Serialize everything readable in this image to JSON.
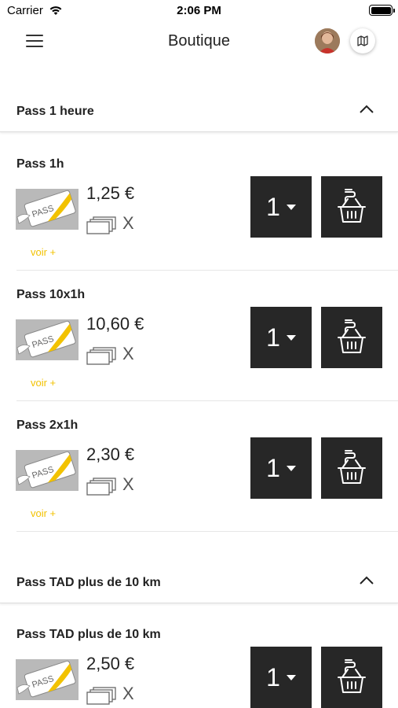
{
  "status_bar": {
    "carrier": "Carrier",
    "time": "2:06 PM"
  },
  "nav": {
    "title": "Boutique"
  },
  "sections": [
    {
      "title": "Pass 1 heure",
      "products": [
        {
          "title": "Pass 1h",
          "price": "1,25 €",
          "count": "X",
          "qty": "1",
          "voir": "voir +",
          "pass_label": "PASS"
        },
        {
          "title": "Pass 10x1h",
          "price": "10,60 €",
          "count": "X",
          "qty": "1",
          "voir": "voir +",
          "pass_label": "PASS"
        },
        {
          "title": "Pass 2x1h",
          "price": "2,30 €",
          "count": "X",
          "qty": "1",
          "voir": "voir +",
          "pass_label": "PASS"
        }
      ]
    },
    {
      "title": "Pass TAD plus de 10 km",
      "products": [
        {
          "title": "Pass TAD plus de 10 km",
          "price": "2,50 €",
          "count": "X",
          "qty": "1",
          "pass_label": "PASS"
        }
      ]
    }
  ],
  "colors": {
    "accent_yellow": "#f2c200",
    "button_dark": "#272727"
  }
}
